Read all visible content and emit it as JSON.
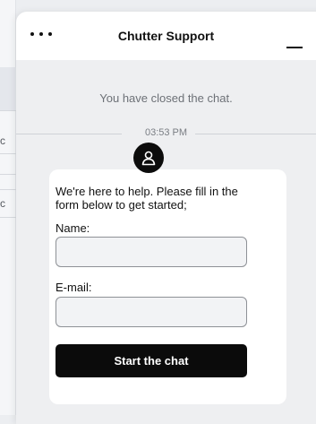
{
  "background": {
    "fragments": [
      "tic",
      "tic"
    ]
  },
  "header": {
    "title": "Chutter Support",
    "menu_icon": "more-horizontal-icon",
    "minimize_icon": "minimize-icon"
  },
  "chat": {
    "closed_message": "You have closed the chat.",
    "timestamp": "03:53 PM"
  },
  "form": {
    "avatar_icon": "user-icon",
    "intro": "We're here to help. Please fill in the form below to get started;",
    "name_label": "Name:",
    "name_value": "",
    "email_label": "E-mail:",
    "email_value": "",
    "submit_label": "Start the chat"
  },
  "colors": {
    "button_bg": "#0b0b0b",
    "panel_bg": "#eeeff1",
    "card_bg": "#ffffff"
  }
}
